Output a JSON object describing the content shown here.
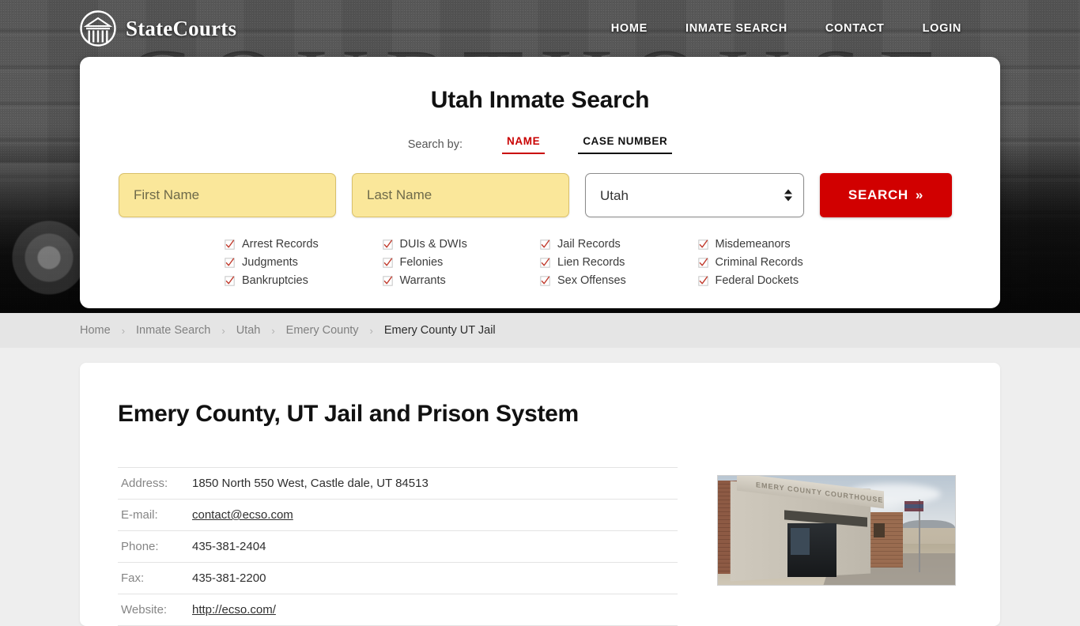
{
  "header": {
    "brand": "StateCourts",
    "logo_icon": "courthouse-circle-logo",
    "nav": [
      {
        "label": "HOME"
      },
      {
        "label": "INMATE SEARCH"
      },
      {
        "label": "CONTACT"
      },
      {
        "label": "LOGIN"
      }
    ],
    "background_word": "COURTHOUSE"
  },
  "search_card": {
    "title": "Utah Inmate Search",
    "search_by_label": "Search by:",
    "tabs": [
      {
        "label": "NAME",
        "active": true,
        "color": "#c90000"
      },
      {
        "label": "CASE NUMBER",
        "active": false,
        "color": "#111111"
      }
    ],
    "first_name_placeholder": "First Name",
    "first_name_value": "",
    "last_name_placeholder": "Last Name",
    "last_name_value": "",
    "state_value": "Utah",
    "state_options": [
      "Utah"
    ],
    "search_button": "SEARCH",
    "search_button_chevron": "»",
    "checks": [
      "Arrest Records",
      "DUIs & DWIs",
      "Jail Records",
      "Misdemeanors",
      "Judgments",
      "Felonies",
      "Lien Records",
      "Criminal Records",
      "Bankruptcies",
      "Warrants",
      "Sex Offenses",
      "Federal Dockets"
    ],
    "check_color": "#c0392b",
    "field_bg": "#fae79a",
    "accent": "#d10000"
  },
  "breadcrumb": {
    "separator": "›",
    "items": [
      {
        "label": "Home",
        "current": false
      },
      {
        "label": "Inmate Search",
        "current": false
      },
      {
        "label": "Utah",
        "current": false
      },
      {
        "label": "Emery County",
        "current": false
      },
      {
        "label": "Emery County UT Jail",
        "current": true
      }
    ]
  },
  "content": {
    "page_title": "Emery County, UT Jail and Prison System",
    "info": [
      {
        "label": "Address:",
        "value": "1850 North 550 West, Castle dale, UT 84513",
        "link": false
      },
      {
        "label": "E-mail:",
        "value": "contact@ecso.com",
        "link": true
      },
      {
        "label": "Phone:",
        "value": "435-381-2404",
        "link": false
      },
      {
        "label": "Fax:",
        "value": "435-381-2200",
        "link": false
      },
      {
        "label": "Website:",
        "value": "http://ecso.com/",
        "link": true
      }
    ],
    "photo_alt": "Emery County Courthouse building photo",
    "photo_sign_text": "EMERY COUNTY COURTHOUSE"
  }
}
